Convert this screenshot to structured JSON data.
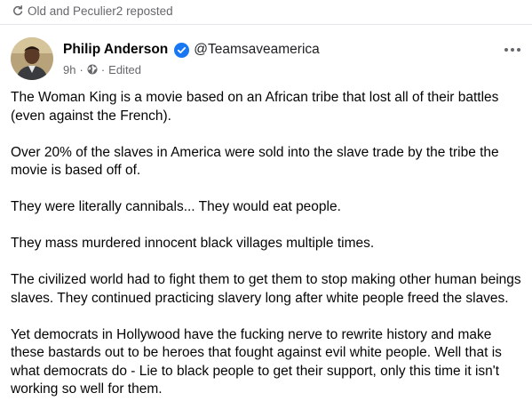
{
  "repost": {
    "icon": "repost-icon",
    "text": "Old and Peculier2 reposted"
  },
  "author": {
    "avatar": "avatar",
    "name": "Philip Anderson",
    "verified_icon": "verified-badge-icon",
    "handle": "@Teamsaveamerica",
    "time": "9h",
    "dot1": "·",
    "privacy_icon": "public-globe-icon",
    "dot2": "·",
    "edited": "Edited"
  },
  "more_icon": "more-options-icon",
  "colors": {
    "secondary_text": "#65676b",
    "verified_blue": "#1877f2",
    "divider": "#e4e6eb"
  },
  "post": {
    "paragraphs": [
      "The Woman King is a movie based on an African tribe that lost all of their battles (even against the French).",
      "Over 20% of the slaves in America were sold into the slave trade by the tribe the movie is based off of.",
      "They were literally cannibals... They would eat people.",
      "They mass murdered innocent black villages multiple times.",
      "The civilized world had to fight them to get them to stop making other human beings slaves. They continued practicing slavery long after white people freed the slaves.",
      "Yet democrats in Hollywood have the fucking nerve to rewrite history and make these bastards out to be heroes that fought against evil white people. Well that is what democrats do - Lie to black people to get their support, only this time it isn't working so well for them."
    ]
  }
}
